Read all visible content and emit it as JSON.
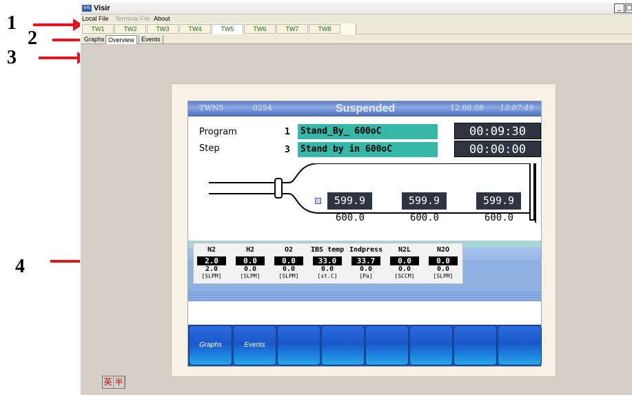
{
  "annotations": [
    "1",
    "2",
    "3",
    "4"
  ],
  "window": {
    "title": "Visir",
    "icon": "app-icon",
    "icon_text": "VIS"
  },
  "menu": {
    "local_file": "Local File",
    "terminal_file": "Terminal File",
    "about": "About"
  },
  "tw_tabs": [
    "TW1",
    "TW2",
    "TW3",
    "TW4",
    "TW5",
    "TW6",
    "TW7",
    "TW8"
  ],
  "tw_active": "TW5",
  "subtabs": [
    "Graphs",
    "Overview",
    "Events"
  ],
  "subtab_active": "Overview",
  "status": {
    "unit": "TWN5",
    "code": "0254",
    "state": "Suspended",
    "date": "12.08.08",
    "time": "13:07:49"
  },
  "program": {
    "program_label": "Program",
    "program_no": "1",
    "program_name": "Stand_By_ 600oC",
    "program_timer": "00:09:30",
    "step_label": "Step",
    "step_no": "3",
    "step_name": "Stand by in 600oC",
    "step_timer": "00:00:00"
  },
  "zones": [
    {
      "actual": "599.9",
      "setpoint": "600.0"
    },
    {
      "actual": "599.9",
      "setpoint": "600.0"
    },
    {
      "actual": "599.9",
      "setpoint": "600.0"
    }
  ],
  "gases": [
    {
      "name": "N2",
      "actual": "2.0",
      "setpoint": "2.0",
      "unit": "[SLPM]"
    },
    {
      "name": "H2",
      "actual": "0.0",
      "setpoint": "0.0",
      "unit": "[SLPM]"
    },
    {
      "name": "O2",
      "actual": "0.0",
      "setpoint": "0.0",
      "unit": "[SLPM]"
    },
    {
      "name": "IBS temp",
      "actual": "33.0",
      "setpoint": "0.0",
      "unit": "[st.C]"
    },
    {
      "name": "Indpress",
      "actual": "33.7",
      "setpoint": "0.0",
      "unit": "[Pa]"
    },
    {
      "name": "N2L",
      "actual": "0.0",
      "setpoint": "0.0",
      "unit": "[SCCM]"
    },
    {
      "name": "N2O",
      "actual": "0.0",
      "setpoint": "0.0",
      "unit": "[SLPM]"
    }
  ],
  "panel_buttons": [
    "Graphs",
    "Events",
    "",
    "",
    "",
    "",
    "",
    "",
    ""
  ],
  "ime": [
    "英",
    "半"
  ],
  "colors": {
    "arrow": "#e8141b",
    "status_bar": "#5d7cc6",
    "program_field": "#37b7a8",
    "panel_button": "#1b58c9"
  }
}
